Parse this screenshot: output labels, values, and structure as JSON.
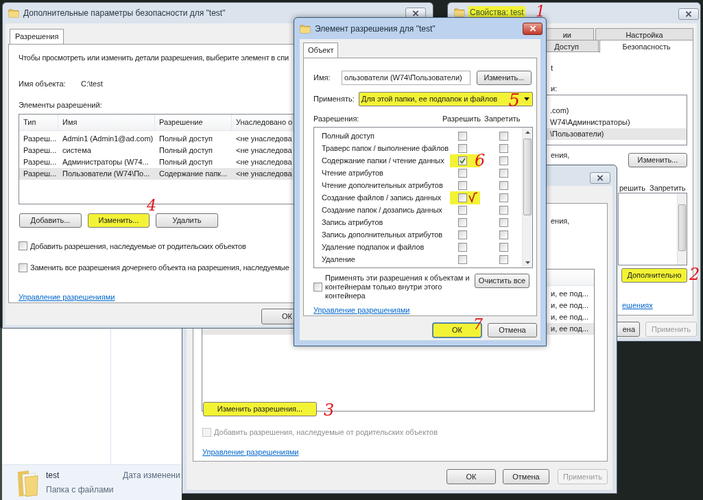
{
  "explorer_details": {
    "name": "test",
    "type": "Папка с файлами",
    "date_label": "Дата изменени"
  },
  "advanced_window": {
    "title": "Дополнительные параметры безопасности  для \"test\"",
    "tabs": [
      {
        "label": "Разрешения",
        "selected": true
      }
    ],
    "intro": "Чтобы просмотреть или изменить детали разрешения, выберите элемент в спи",
    "object_label": "Имя объекта:",
    "object_value": "C:\\test",
    "entries_label": "Элементы разрешений:",
    "columns": [
      "Тип",
      "Имя",
      "Разрешение",
      "Унаследовано о"
    ],
    "rows": [
      {
        "cells": [
          "Разреш...",
          "Admin1 (Admin1@ad.com)",
          "Полный доступ",
          "<не унаследова"
        ],
        "selected": false
      },
      {
        "cells": [
          "Разреш...",
          "система",
          "Полный доступ",
          "<не унаследова"
        ],
        "selected": false
      },
      {
        "cells": [
          "Разреш...",
          "Администраторы (W74...",
          "Полный доступ",
          "<не унаследова"
        ],
        "selected": false
      },
      {
        "cells": [
          "Разреш...",
          "Пользователи (W74\\По...",
          "Содержание папк...",
          "<не унаследова"
        ],
        "selected": true
      }
    ],
    "buttons": [
      {
        "label": "Добавить...",
        "highlighted": false
      },
      {
        "label": "Изменить...",
        "highlighted": true,
        "note": "4"
      },
      {
        "label": "Удалить",
        "highlighted": false
      }
    ],
    "checkboxes": [
      {
        "label": "Добавить разрешения, наследуемые от родительских объектов",
        "checked": false
      },
      {
        "label": "Заменить все разрешения дочернего объекта на разрешения, наследуемые",
        "checked": false
      }
    ],
    "link": "Управление разрешениями",
    "ok_button": "ОК"
  },
  "properties_window": {
    "title": "Свойства: test",
    "title_highlighted": true,
    "title_note": "1",
    "tabs": [
      {
        "label": "ии",
        "selected": false
      },
      {
        "label": "Настройка",
        "selected": false
      },
      {
        "label": "Доступ",
        "selected": false
      },
      {
        "label": "Безопасность",
        "selected": true
      }
    ],
    "object_fragment": "t",
    "groups_fragment": "и:",
    "principals": [
      {
        "label": ".com)",
        "selected": false
      },
      {
        "label": "W74\\Администраторы)",
        "selected": false
      },
      {
        "label": "\\Пользователи)",
        "selected": true
      }
    ],
    "note_fragment": "ения,",
    "edit_button": "Изменить...",
    "allow_header": "решить",
    "deny_header": "Запретить",
    "advanced_button": {
      "label": "Дополнительно",
      "highlighted": true,
      "note": "2"
    },
    "link_fragment": "ешениях",
    "buttons": [
      {
        "label": "ена",
        "disabled": false
      },
      {
        "label": "Применить",
        "disabled": true
      }
    ]
  },
  "permissions_window": {
    "note_fragment": "ения,",
    "rows": [
      {
        "text": "и, ее под...",
        "selected": false
      },
      {
        "text": "и, ее под...",
        "selected": false
      },
      {
        "text": "и, ее под...",
        "selected": false
      },
      {
        "text": "и, ее под...",
        "selected": true
      }
    ],
    "edit_button": {
      "label": "Изменить разрешения...",
      "highlighted": true,
      "note": "3"
    },
    "inherit_checkbox": {
      "label": "Добавить разрешения, наследуемые от родительских объектов",
      "checked": false,
      "disabled": true
    },
    "link": "Управление разрешениями",
    "buttons": [
      {
        "label": "ОК",
        "disabled": false
      },
      {
        "label": "Отмена",
        "disabled": false
      },
      {
        "label": "Применить",
        "disabled": true
      }
    ]
  },
  "entry_dialog": {
    "title": "Элемент разрешения для \"test\"",
    "tabs": [
      {
        "label": "Объект",
        "selected": true
      }
    ],
    "name_label": "Имя:",
    "name_value": "ользователи (W74\\Пользователи)",
    "change_button": "Изменить...",
    "apply_label": "Применять:",
    "apply_value": "Для этой папки, ее подпапок и файлов",
    "apply_highlighted": true,
    "apply_note": "5",
    "permissions_label": "Разрешения:",
    "allow_header": "Разрешить",
    "deny_header": "Запретить",
    "permissions": [
      {
        "label": "Полный доступ",
        "allow": false,
        "deny": false,
        "highlighted": false
      },
      {
        "label": "Траверс папок / выполнение файлов",
        "allow": false,
        "deny": false,
        "highlighted": false
      },
      {
        "label": "Содержание папки / чтение данных",
        "allow": true,
        "deny": false,
        "highlighted": true,
        "note": "6"
      },
      {
        "label": "Чтение атрибутов",
        "allow": false,
        "deny": false,
        "highlighted": false
      },
      {
        "label": "Чтение дополнительных атрибутов",
        "allow": false,
        "deny": false,
        "highlighted": false
      },
      {
        "label": "Создание файлов / запись данных",
        "allow": false,
        "deny": false,
        "highlighted": true,
        "hand_tick": true
      },
      {
        "label": "Создание папок / дозапись данных",
        "allow": false,
        "deny": false,
        "highlighted": false
      },
      {
        "label": "Запись атрибутов",
        "allow": false,
        "deny": false,
        "highlighted": false
      },
      {
        "label": "Запись дополнительных атрибутов",
        "allow": false,
        "deny": false,
        "highlighted": false
      },
      {
        "label": "Удаление подпапок и файлов",
        "allow": false,
        "deny": false,
        "highlighted": false
      },
      {
        "label": "Удаление",
        "allow": false,
        "deny": false,
        "highlighted": false
      }
    ],
    "inner_only": {
      "label": "Применять эти разрешения к объектам и контейнерам только внутри этого контейнера",
      "checked": false
    },
    "clear_button": "Очистить все",
    "link": "Управление разрешениями",
    "buttons": [
      {
        "label": "ОК",
        "default": true,
        "highlighted": true,
        "note": "7"
      },
      {
        "label": "Отмена",
        "default": false,
        "highlighted": false
      }
    ]
  }
}
